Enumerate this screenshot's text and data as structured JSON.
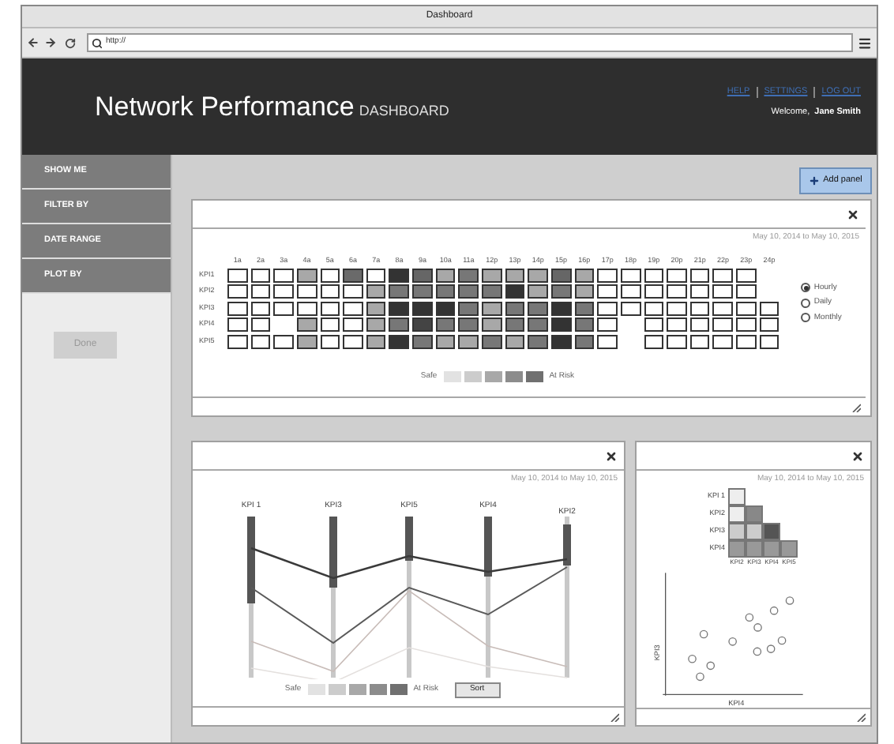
{
  "window": {
    "title": "Dashboard"
  },
  "address_bar": {
    "value": "http://"
  },
  "header": {
    "title": "Network Performance",
    "subtitle": "DASHBOARD",
    "links": [
      "HELP",
      "SETTINGS",
      "LOG OUT"
    ],
    "welcome": "Welcome,",
    "user": "Jane Smith"
  },
  "sidebar": {
    "items": [
      {
        "label": "SHOW ME"
      },
      {
        "label": "FILTER BY"
      },
      {
        "label": "DATE RANGE"
      },
      {
        "label": "PLOT BY"
      }
    ],
    "done_button": {
      "label": "Done",
      "disabled": true
    }
  },
  "add_panel_button": {
    "label": "Add panel"
  },
  "heatmap_panel": {
    "date_range": "May 10, 2014 to May 10, 2015",
    "columns": [
      "1a",
      "2a",
      "3a",
      "4a",
      "5a",
      "6a",
      "7a",
      "8a",
      "9a",
      "10a",
      "11a",
      "12p",
      "13p",
      "14p",
      "15p",
      "16p",
      "17p",
      "18p",
      "19p",
      "20p",
      "21p",
      "22p",
      "23p",
      "24p"
    ],
    "rows": [
      {
        "label": "KPI1",
        "cells": [
          {
            "color": "#ffffff"
          },
          {
            "color": "#ffffff"
          },
          {
            "color": "#ffffff"
          },
          {
            "color": "#a8a8a8"
          },
          {
            "color": "#ffffff"
          },
          {
            "color": "#6a6a6a"
          },
          {
            "color": "#ffffff"
          },
          {
            "color": "#333333"
          },
          {
            "color": "#666666"
          },
          {
            "color": "#a8a8a8"
          },
          {
            "color": "#777777"
          },
          {
            "color": "#a8a8a8"
          },
          {
            "color": "#a8a8a8"
          },
          {
            "color": "#a8a8a8"
          },
          {
            "color": "#666666"
          },
          {
            "color": "#a8a8a8"
          },
          {
            "color": "#ffffff"
          },
          {
            "color": "#ffffff"
          },
          {
            "color": "#ffffff"
          },
          {
            "color": "#ffffff"
          },
          {
            "color": "#ffffff"
          },
          {
            "color": "#ffffff"
          },
          {
            "color": "#ffffff"
          },
          {
            "empty": true
          }
        ]
      },
      {
        "label": "KPI2",
        "cells": [
          {
            "color": "#ffffff"
          },
          {
            "color": "#ffffff"
          },
          {
            "color": "#ffffff"
          },
          {
            "color": "#ffffff"
          },
          {
            "color": "#ffffff"
          },
          {
            "color": "#ffffff"
          },
          {
            "color": "#a8a8a8"
          },
          {
            "color": "#777777"
          },
          {
            "color": "#777777"
          },
          {
            "color": "#777777"
          },
          {
            "color": "#777777"
          },
          {
            "color": "#777777"
          },
          {
            "color": "#333333"
          },
          {
            "color": "#a8a8a8"
          },
          {
            "color": "#777777"
          },
          {
            "color": "#a8a8a8"
          },
          {
            "color": "#ffffff"
          },
          {
            "color": "#ffffff"
          },
          {
            "color": "#ffffff"
          },
          {
            "color": "#ffffff"
          },
          {
            "color": "#ffffff"
          },
          {
            "color": "#ffffff"
          },
          {
            "color": "#ffffff"
          },
          {
            "empty": true
          }
        ]
      },
      {
        "label": "KPI3",
        "cells": [
          {
            "color": "#ffffff"
          },
          {
            "color": "#ffffff"
          },
          {
            "color": "#ffffff"
          },
          {
            "color": "#ffffff"
          },
          {
            "color": "#ffffff"
          },
          {
            "color": "#ffffff"
          },
          {
            "color": "#a8a8a8"
          },
          {
            "color": "#333333"
          },
          {
            "color": "#333333"
          },
          {
            "color": "#333333"
          },
          {
            "color": "#777777"
          },
          {
            "color": "#a8a8a8"
          },
          {
            "color": "#777777"
          },
          {
            "color": "#777777"
          },
          {
            "color": "#333333"
          },
          {
            "color": "#777777"
          },
          {
            "color": "#ffffff"
          },
          {
            "color": "#ffffff"
          },
          {
            "color": "#ffffff"
          },
          {
            "color": "#ffffff"
          },
          {
            "color": "#ffffff"
          },
          {
            "color": "#ffffff"
          },
          {
            "color": "#ffffff"
          },
          {
            "color": "#ffffff"
          }
        ]
      },
      {
        "label": "KPI4",
        "cells": [
          {
            "color": "#ffffff"
          },
          {
            "color": "#ffffff"
          },
          {
            "empty": true
          },
          {
            "color": "#a8a8a8"
          },
          {
            "color": "#ffffff"
          },
          {
            "color": "#ffffff"
          },
          {
            "color": "#a8a8a8"
          },
          {
            "color": "#777777"
          },
          {
            "color": "#444444"
          },
          {
            "color": "#777777"
          },
          {
            "color": "#777777"
          },
          {
            "color": "#a8a8a8"
          },
          {
            "color": "#777777"
          },
          {
            "color": "#777777"
          },
          {
            "color": "#333333"
          },
          {
            "color": "#777777"
          },
          {
            "color": "#ffffff"
          },
          {
            "empty": true
          },
          {
            "color": "#ffffff"
          },
          {
            "color": "#ffffff"
          },
          {
            "color": "#ffffff"
          },
          {
            "color": "#ffffff"
          },
          {
            "color": "#ffffff"
          },
          {
            "color": "#ffffff"
          }
        ]
      },
      {
        "label": "KPI5",
        "cells": [
          {
            "color": "#ffffff"
          },
          {
            "color": "#ffffff"
          },
          {
            "color": "#ffffff"
          },
          {
            "color": "#a8a8a8"
          },
          {
            "color": "#ffffff"
          },
          {
            "color": "#ffffff"
          },
          {
            "color": "#a8a8a8"
          },
          {
            "color": "#333333"
          },
          {
            "color": "#777777"
          },
          {
            "color": "#a8a8a8"
          },
          {
            "color": "#a8a8a8"
          },
          {
            "color": "#777777"
          },
          {
            "color": "#a8a8a8"
          },
          {
            "color": "#777777"
          },
          {
            "color": "#333333"
          },
          {
            "color": "#777777"
          },
          {
            "color": "#ffffff"
          },
          {
            "empty": true
          },
          {
            "color": "#ffffff"
          },
          {
            "color": "#ffffff"
          },
          {
            "color": "#ffffff"
          },
          {
            "color": "#ffffff"
          },
          {
            "color": "#ffffff"
          },
          {
            "color": "#ffffff"
          }
        ]
      }
    ],
    "options": [
      {
        "label": "Hourly",
        "selected": true
      },
      {
        "label": "Daily",
        "selected": false
      },
      {
        "label": "Monthly",
        "selected": false
      }
    ],
    "legend": {
      "low": "Safe",
      "high": "At Risk",
      "swatches": [
        {
          "color": "#e2e2e2"
        },
        {
          "color": "#cccccc"
        },
        {
          "color": "#a8a8a8"
        },
        {
          "color": "#8c8c8c"
        },
        {
          "color": "#707070"
        }
      ]
    }
  },
  "parallel_panel": {
    "date_range": "May 10, 2014 to May 10, 2015",
    "axes": [
      "KPI 1",
      "KPI3",
      "KPI5",
      "KPI4",
      "KPI2"
    ],
    "legend": {
      "low": "Safe",
      "high": "At Risk",
      "swatches": [
        {
          "color": "#e2e2e2"
        },
        {
          "color": "#cccccc"
        },
        {
          "color": "#a8a8a8"
        },
        {
          "color": "#8c8c8c"
        },
        {
          "color": "#707070"
        }
      ]
    },
    "sort_button": "Sort"
  },
  "correlation_panel": {
    "date_range": "May 10, 2014 to May 10, 2015",
    "row_labels": [
      "KPI 1",
      "KPI2",
      "KPI3",
      "KPI4"
    ],
    "column_labels": [
      "KPI2",
      "KPI3",
      "KPI4",
      "KPI5"
    ],
    "rows": [
      {
        "cells": [
          {
            "color": "#eeeeee"
          }
        ]
      },
      {
        "cells": [
          {
            "color": "#eeeeee"
          },
          {
            "color": "#888888"
          }
        ]
      },
      {
        "cells": [
          {
            "color": "#cccccc"
          },
          {
            "color": "#cccccc"
          },
          {
            "color": "#555555"
          }
        ]
      },
      {
        "cells": [
          {
            "color": "#999999"
          },
          {
            "color": "#999999"
          },
          {
            "color": "#999999"
          },
          {
            "color": "#999999"
          }
        ]
      }
    ],
    "scatter": {
      "xlabel": "KPI4",
      "ylabel": "KPI3"
    }
  }
}
